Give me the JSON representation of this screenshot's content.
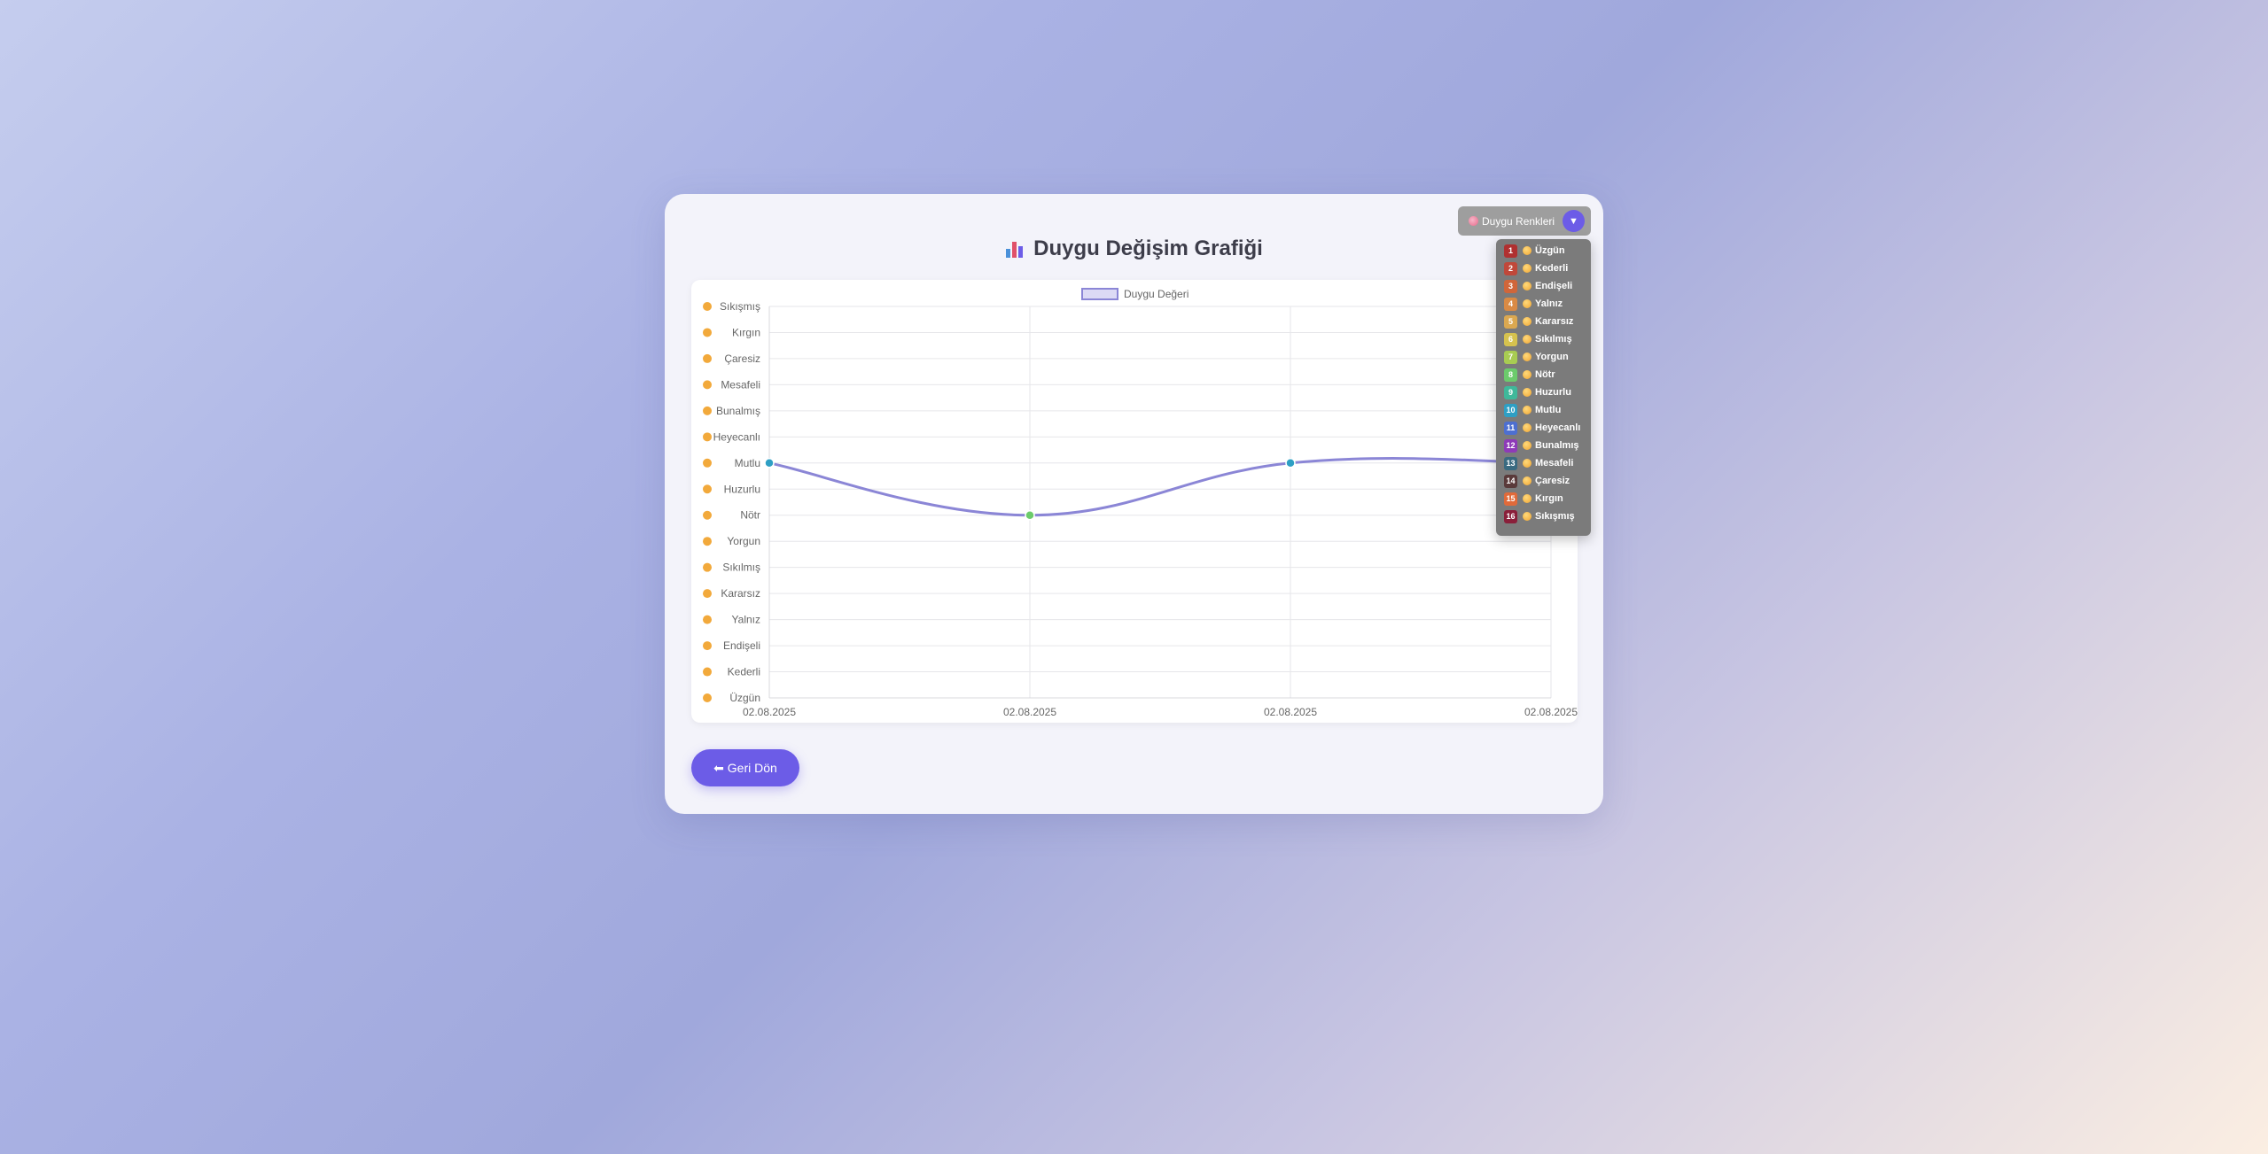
{
  "page": {
    "title": "Duygu Değişim Grafiği",
    "back_label": "⬅ Geri Dön"
  },
  "legend_panel": {
    "button_label": "Duygu Renkleri",
    "toggle_icon": "▼",
    "items": [
      {
        "num": "1",
        "label": "Üzgün",
        "color": "#b03030"
      },
      {
        "num": "2",
        "label": "Kederli",
        "color": "#c0483a"
      },
      {
        "num": "3",
        "label": "Endişeli",
        "color": "#d0663a"
      },
      {
        "num": "4",
        "label": "Yalnız",
        "color": "#d98a44"
      },
      {
        "num": "5",
        "label": "Kararsız",
        "color": "#dba850"
      },
      {
        "num": "6",
        "label": "Sıkılmış",
        "color": "#d6c24e"
      },
      {
        "num": "7",
        "label": "Yorgun",
        "color": "#a8cc52"
      },
      {
        "num": "8",
        "label": "Nötr",
        "color": "#6ccb6c"
      },
      {
        "num": "9",
        "label": "Huzurlu",
        "color": "#3fb89a"
      },
      {
        "num": "10",
        "label": "Mutlu",
        "color": "#2e9fc4"
      },
      {
        "num": "11",
        "label": "Heyecanlı",
        "color": "#4d6fd0"
      },
      {
        "num": "12",
        "label": "Bunalmış",
        "color": "#8e3ab8"
      },
      {
        "num": "13",
        "label": "Mesafeli",
        "color": "#3a6a80"
      },
      {
        "num": "14",
        "label": "Çaresiz",
        "color": "#5a3a3a"
      },
      {
        "num": "15",
        "label": "Kırgın",
        "color": "#e06a3a"
      },
      {
        "num": "16",
        "label": "Sıkışmış",
        "color": "#8a1f3a"
      }
    ]
  },
  "chart_data": {
    "type": "line",
    "legend": "Duygu Değeri",
    "line_color": "#8b86d6",
    "y_categories": [
      "Üzgün",
      "Kederli",
      "Endişeli",
      "Yalnız",
      "Kararsız",
      "Sıkılmış",
      "Yorgun",
      "Nötr",
      "Huzurlu",
      "Mutlu",
      "Heyecanlı",
      "Bunalmış",
      "Mesafeli",
      "Çaresiz",
      "Kırgın",
      "Sıkışmış"
    ],
    "x": [
      "02.08.2025",
      "02.08.2025",
      "02.08.2025",
      "02.08.2025"
    ],
    "values": [
      10,
      8,
      10,
      10
    ],
    "point_colors": [
      "#2e9fc4",
      "#6ccb6c",
      "#2e9fc4",
      "#2e9fc4"
    ],
    "ylim": [
      1,
      16
    ]
  }
}
